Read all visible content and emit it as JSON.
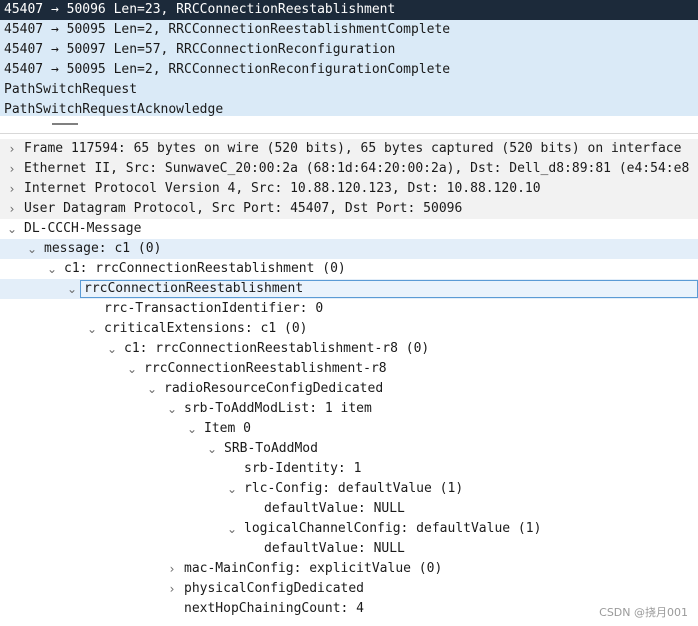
{
  "packet_list": {
    "rows": [
      {
        "text": "45407 → 50096 Len=23, RRCConnectionReestablishment",
        "selected": true
      },
      {
        "text": "45407 → 50095 Len=2, RRCConnectionReestablishmentComplete",
        "selected": false
      },
      {
        "text": "45407 → 50097 Len=57, RRCConnectionReconfiguration",
        "selected": false
      },
      {
        "text": "45407 → 50095 Len=2, RRCConnectionReconfigurationComplete",
        "selected": false
      },
      {
        "text": "PathSwitchRequest",
        "selected": false
      },
      {
        "text": "PathSwitchRequestAcknowledge",
        "selected": false
      }
    ]
  },
  "packet_details": {
    "rows": [
      {
        "text": "Frame 117594: 65 bytes on wire (520 bits), 65 bytes captured (520 bits) on interface",
        "state": "collapsed",
        "level": 0,
        "style": "summary"
      },
      {
        "text": "Ethernet II, Src: SunwaveC_20:00:2a (68:1d:64:20:00:2a), Dst: Dell_d8:89:81 (e4:54:e8",
        "state": "collapsed",
        "level": 0,
        "style": "summary"
      },
      {
        "text": "Internet Protocol Version 4, Src: 10.88.120.123, Dst: 10.88.120.10",
        "state": "collapsed",
        "level": 0,
        "style": "summary"
      },
      {
        "text": "User Datagram Protocol, Src Port: 45407, Dst Port: 50096",
        "state": "collapsed",
        "level": 0,
        "style": "summary"
      },
      {
        "text": "DL-CCCH-Message",
        "state": "expanded",
        "level": 0,
        "style": ""
      },
      {
        "text": "message: c1 (0)",
        "state": "expanded",
        "level": 1,
        "style": "hl"
      },
      {
        "text": "c1: rrcConnectionReestablishment (0)",
        "state": "expanded",
        "level": 2,
        "style": ""
      },
      {
        "text": "rrcConnectionReestablishment",
        "state": "expanded",
        "level": 3,
        "style": "focused"
      },
      {
        "text": "rrc-TransactionIdentifier: 0",
        "state": "leaf",
        "level": 4,
        "style": ""
      },
      {
        "text": "criticalExtensions: c1 (0)",
        "state": "expanded",
        "level": 4,
        "style": ""
      },
      {
        "text": "c1: rrcConnectionReestablishment-r8 (0)",
        "state": "expanded",
        "level": 5,
        "style": ""
      },
      {
        "text": "rrcConnectionReestablishment-r8",
        "state": "expanded",
        "level": 6,
        "style": ""
      },
      {
        "text": "radioResourceConfigDedicated",
        "state": "expanded",
        "level": 7,
        "style": ""
      },
      {
        "text": "srb-ToAddModList: 1 item",
        "state": "expanded",
        "level": 8,
        "style": ""
      },
      {
        "text": "Item 0",
        "state": "expanded",
        "level": 9,
        "style": ""
      },
      {
        "text": "SRB-ToAddMod",
        "state": "expanded",
        "level": 10,
        "style": ""
      },
      {
        "text": "srb-Identity: 1",
        "state": "leaf",
        "level": 11,
        "style": ""
      },
      {
        "text": "rlc-Config: defaultValue (1)",
        "state": "expanded",
        "level": 11,
        "style": ""
      },
      {
        "text": "defaultValue: NULL",
        "state": "leaf",
        "level": 12,
        "style": ""
      },
      {
        "text": "logicalChannelConfig: defaultValue (1)",
        "state": "expanded",
        "level": 11,
        "style": ""
      },
      {
        "text": "defaultValue: NULL",
        "state": "leaf",
        "level": 12,
        "style": ""
      },
      {
        "text": "mac-MainConfig: explicitValue (0)",
        "state": "collapsed",
        "level": 8,
        "style": ""
      },
      {
        "text": "physicalConfigDedicated",
        "state": "collapsed",
        "level": 8,
        "style": ""
      },
      {
        "text": "nextHopChainingCount: 4",
        "state": "leaf",
        "level": 8,
        "style": ""
      }
    ]
  },
  "icons": {
    "collapsed": "chevron-right-icon",
    "expanded": "chevron-down-icon"
  },
  "watermark": "CSDN @挠月001"
}
